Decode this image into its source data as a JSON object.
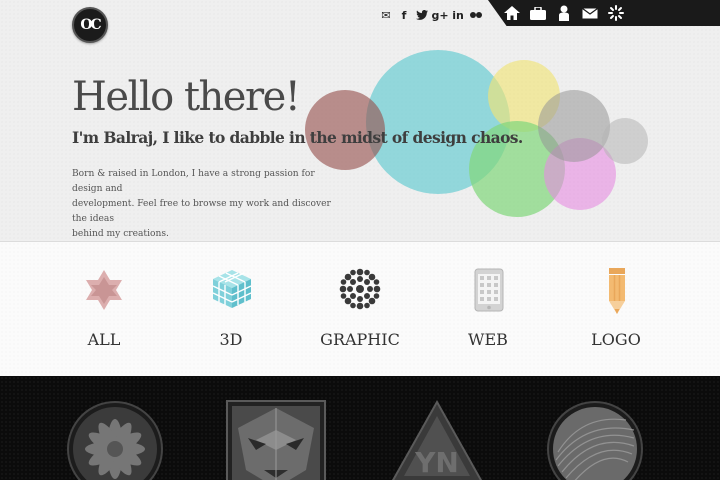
{
  "header": {
    "logo_text": "OC",
    "social_icons": [
      "mail-icon",
      "facebook-icon",
      "twitter-icon",
      "google-plus-icon",
      "linkedin-icon",
      "flickr-icon"
    ],
    "social_glyphs": [
      "✉",
      "f",
      "🐦",
      "g+",
      "in",
      "••"
    ],
    "nav_icons": [
      "home-icon",
      "briefcase-icon",
      "person-icon",
      "mail-icon",
      "settings-icon"
    ]
  },
  "hero": {
    "title": "Hello there!",
    "subtitle": "I'm Balraj, I like to dabble in the midst of design chaos.",
    "intro_line1": "Born & raised in London, I have a strong passion for design and",
    "intro_line2": "development. Feel free to browse my work and discover the ideas",
    "intro_line3": "behind my creations.",
    "circle_colors": [
      "#7fd3d6",
      "#a25e5b",
      "#f3e98e",
      "#8fdc8a",
      "#e59fe3",
      "#a4a4a4",
      "#c6c6c6"
    ]
  },
  "categories": [
    {
      "label": "ALL",
      "icon": "star-icon",
      "color": "#d8a6a6"
    },
    {
      "label": "3D",
      "icon": "cube-icon",
      "color": "#7fd3dc"
    },
    {
      "label": "GRAPHIC",
      "icon": "flower-icon",
      "color": "#3a3a3a"
    },
    {
      "label": "WEB",
      "icon": "tablet-icon",
      "color": "#c4c4c4"
    },
    {
      "label": "LOGO",
      "icon": "pencil-icon",
      "color": "#f0b66a"
    }
  ],
  "works": [
    {
      "name": "work-flower-circle"
    },
    {
      "name": "work-face-square"
    },
    {
      "name": "work-triangle"
    },
    {
      "name": "work-swirl-circle"
    }
  ]
}
